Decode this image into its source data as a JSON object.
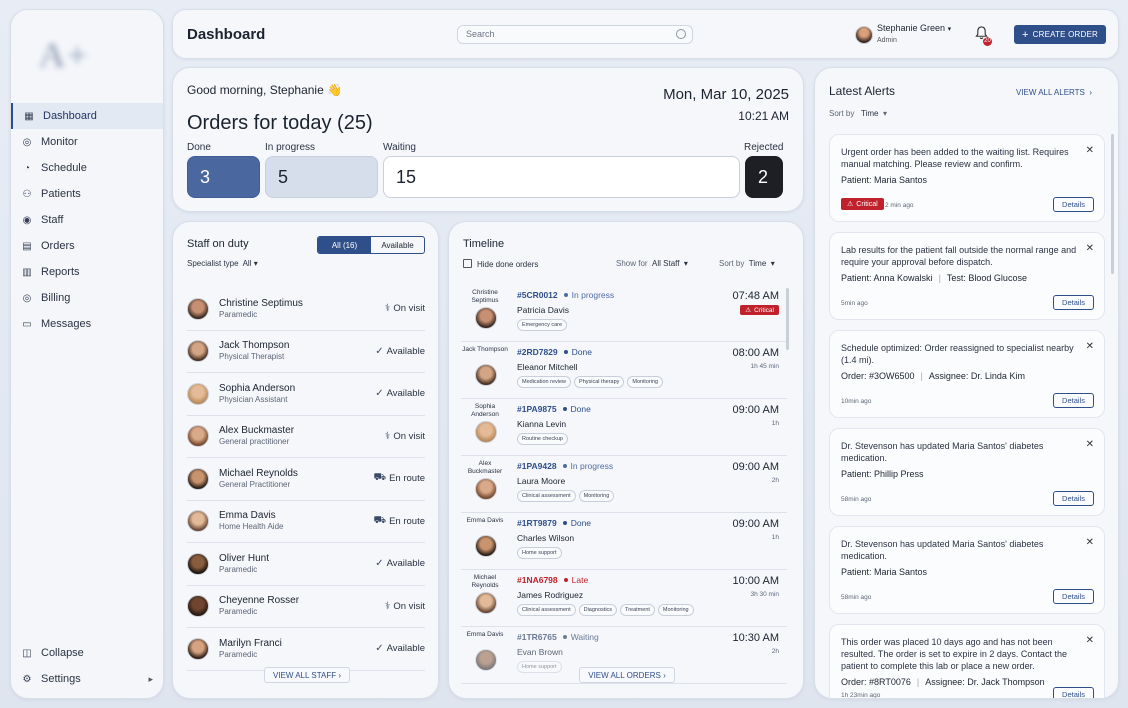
{
  "sidebar": {
    "logo": "A+",
    "items": [
      {
        "label": "Dashboard",
        "icon": "dashboard-icon"
      },
      {
        "label": "Monitor",
        "icon": "monitor-icon"
      },
      {
        "label": "Schedule",
        "icon": "schedule-icon"
      },
      {
        "label": "Patients",
        "icon": "patients-icon"
      },
      {
        "label": "Staff",
        "icon": "staff-icon"
      },
      {
        "label": "Orders",
        "icon": "orders-icon"
      },
      {
        "label": "Reports",
        "icon": "reports-icon"
      },
      {
        "label": "Billing",
        "icon": "billing-icon"
      },
      {
        "label": "Messages",
        "icon": "messages-icon"
      }
    ],
    "collapse": "Collapse",
    "settings": "Settings"
  },
  "header": {
    "title": "Dashboard",
    "search_placeholder": "Search",
    "user_name": "Stephanie Green",
    "user_role": "Admin",
    "notifications": "20",
    "create_order": "CREATE ORDER"
  },
  "orders": {
    "greeting": "Good morning, Stephanie 👋",
    "date": "Mon, Mar 10, 2025",
    "time": "10:21 AM",
    "title": "Orders for today (25)",
    "stats": [
      {
        "label": "Done",
        "value": "3"
      },
      {
        "label": "In progress",
        "value": "5"
      },
      {
        "label": "Waiting",
        "value": "15"
      },
      {
        "label": "Rejected",
        "value": "2"
      }
    ]
  },
  "staff": {
    "title": "Staff on duty",
    "toggle_all": "All (16)",
    "toggle_available": "Available",
    "filter_label": "Specialist type",
    "filter_value": "All",
    "view_all": "VIEW ALL STAFF",
    "members": [
      {
        "name": "Christine Septimus",
        "role": "Paramedic",
        "status": "On visit"
      },
      {
        "name": "Jack Thompson",
        "role": "Physical Therapist",
        "status": "Available"
      },
      {
        "name": "Sophia Anderson",
        "role": "Physician Assistant",
        "status": "Available"
      },
      {
        "name": "Alex Buckmaster",
        "role": "General practitioner",
        "status": "On visit"
      },
      {
        "name": "Michael Reynolds",
        "role": "General Practitioner",
        "status": "En route"
      },
      {
        "name": "Emma Davis",
        "role": "Home Health Aide",
        "status": "En route"
      },
      {
        "name": "Oliver Hunt",
        "role": "Paramedic",
        "status": "Available"
      },
      {
        "name": "Cheyenne Rosser",
        "role": "Paramedic",
        "status": "On visit"
      },
      {
        "name": "Marilyn Franci",
        "role": "Paramedic",
        "status": "Available"
      }
    ]
  },
  "timeline": {
    "title": "Timeline",
    "hide_done": "Hide done orders",
    "show_for_label": "Show for",
    "show_for_value": "All Staff",
    "sort_label": "Sort by",
    "sort_value": "Time",
    "view_all": "VIEW ALL ORDERS",
    "critical": "Critical",
    "orders": [
      {
        "staff": "Christine Septimus",
        "id": "#5CR0012",
        "status": "In progress",
        "patient": "Patricia Davis",
        "tags": [
          "Emergency care"
        ],
        "time": "07:48 AM",
        "duration": ""
      },
      {
        "staff": "Jack Thompson",
        "id": "#2RD7829",
        "status": "Done",
        "patient": "Eleanor Mitchell",
        "tags": [
          "Medication review",
          "Physical therapy",
          "Monitoring"
        ],
        "time": "08:00 AM",
        "duration": "1h 45 min"
      },
      {
        "staff": "Sophia Anderson",
        "id": "#1PA9875",
        "status": "Done",
        "patient": "Kianna Levin",
        "tags": [
          "Routine checkup"
        ],
        "time": "09:00 AM",
        "duration": "1h"
      },
      {
        "staff": "Alex Buckmaster",
        "id": "#1PA9428",
        "status": "In progress",
        "patient": "Laura Moore",
        "tags": [
          "Clinical assessment",
          "Monitoring"
        ],
        "time": "09:00 AM",
        "duration": "2h"
      },
      {
        "staff": "Emma Davis",
        "id": "#1RT9879",
        "status": "Done",
        "patient": "Charles Wilson",
        "tags": [
          "Home support"
        ],
        "time": "09:00 AM",
        "duration": "1h"
      },
      {
        "staff": "Michael Reynolds",
        "id": "#1NA6798",
        "status": "Late",
        "patient": "James Rodriguez",
        "tags": [
          "Clinical assessment",
          "Diagnostics",
          "Treatment",
          "Monitoring"
        ],
        "time": "10:00 AM",
        "duration": "3h 30 min"
      },
      {
        "staff": "Emma Davis",
        "id": "#1TR6765",
        "status": "Waiting",
        "patient": "Evan Brown",
        "tags": [
          "Home support"
        ],
        "time": "10:30 AM",
        "duration": "2h"
      }
    ]
  },
  "alerts": {
    "title": "Latest Alerts",
    "view_all": "VIEW ALL ALERTS",
    "sort_label": "Sort by",
    "sort_value": "Time",
    "details": "Details",
    "critical": "Critical",
    "items": [
      {
        "message": "Urgent order has been added to the waiting list. Requires manual matching. Please review and confirm.",
        "meta1": "Patient: Maria Santos",
        "meta2": "",
        "ago": "2 min ago"
      },
      {
        "message": "Lab results for the patient fall outside the normal range and require your approval before dispatch.",
        "meta1": "Patient: Anna Kowalski",
        "meta2": "Test: Blood Glucose",
        "ago": "5min ago"
      },
      {
        "message": "Schedule optimized: Order reassigned to specialist nearby (1.4 mi).",
        "meta1": "Order: #3OW6500",
        "meta2": "Assignee: Dr. Linda Kim",
        "ago": "10min ago"
      },
      {
        "message": "Dr. Stevenson has updated Maria Santos' diabetes medication.",
        "meta1": "Patient: Phillip Press",
        "meta2": "",
        "ago": "58min ago"
      },
      {
        "message": "Dr. Stevenson has updated Maria Santos' diabetes medication.",
        "meta1": "Patient: Maria Santos",
        "meta2": "",
        "ago": "58min ago"
      },
      {
        "message": "This order was placed 10 days ago and has not been resulted. The order is set to expire in 2 days. Contact the patient to complete this lab or place a new order.",
        "meta1": "Order: #8RT0076",
        "meta2": "Assignee: Dr. Jack Thompson",
        "ago": "1h 23min ago"
      }
    ]
  },
  "colors": {
    "accent": "#2f4f8a",
    "critical": "#c0212b",
    "done": "#2f4f8a",
    "progress": "#4f6da3",
    "late": "#c0212b",
    "waiting": "#6b7a96"
  }
}
